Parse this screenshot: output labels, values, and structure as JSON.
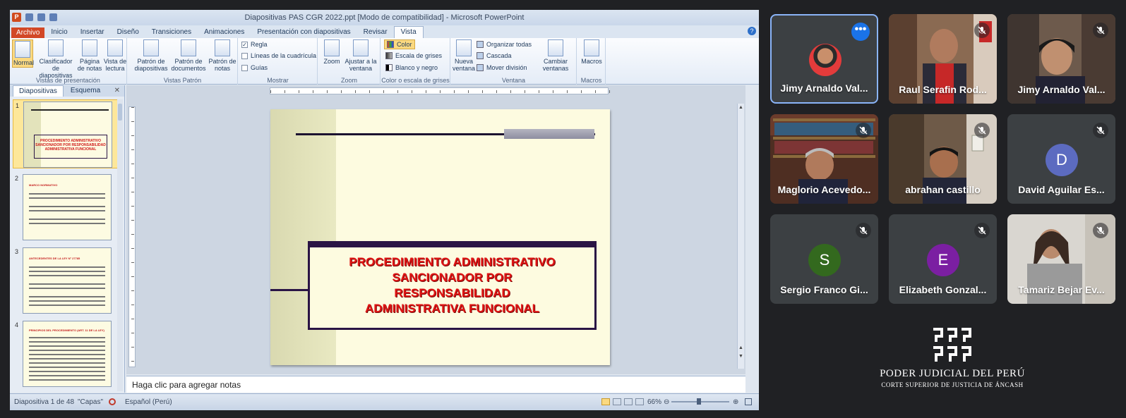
{
  "ppt": {
    "window_title": "Diapositivas PAS CGR 2022.ppt [Modo de compatibilidad] - Microsoft PowerPoint",
    "tabs": [
      "Archivo",
      "Inicio",
      "Insertar",
      "Diseño",
      "Transiciones",
      "Animaciones",
      "Presentación con diapositivas",
      "Revisar",
      "Vista"
    ],
    "active_tab": "Vista",
    "ribbon": {
      "views": {
        "normal": "Normal",
        "sorter": "Clasificador de diapositivas",
        "notes_page": "Página de notas",
        "reading": "Vista de lectura",
        "group": "Vistas de presentación"
      },
      "masters": {
        "slide_master": "Patrón de diapositivas",
        "handout_master": "Patrón de documentos",
        "notes_master": "Patrón de notas",
        "group": "Vistas Patrón"
      },
      "show": {
        "ruler": "Regla",
        "gridlines": "Líneas de la cuadrícula",
        "guides": "Guías",
        "group": "Mostrar",
        "ruler_checked": true
      },
      "zoom": {
        "zoom": "Zoom",
        "fit": "Ajustar a la ventana",
        "group": "Zoom"
      },
      "color": {
        "color": "Color",
        "grayscale": "Escala de grises",
        "bw": "Blanco y negro",
        "group": "Color o escala de grises"
      },
      "window": {
        "new": "Nueva ventana",
        "arrange": "Organizar todas",
        "cascade": "Cascada",
        "move_split": "Mover división",
        "switch": "Cambiar ventanas",
        "group": "Ventana"
      },
      "macros": {
        "macros": "Macros",
        "group": "Macros"
      }
    },
    "pane_tabs": {
      "slides": "Diapositivas",
      "outline": "Esquema"
    },
    "thumbnails": [
      {
        "num": "1",
        "title": "PROCEDIMIENTO ADMINISTRATIVO SANCIONADOR POR RESPONSABILIDAD ADMINISTRATIVA FUNCIONAL"
      },
      {
        "num": "2",
        "title": "MARCO NORMATIVO"
      },
      {
        "num": "3",
        "title": "ANTECEDENTES DE LA LEY N° 27785"
      },
      {
        "num": "4",
        "title": "PRINCIPIOS DEL PROCEDIMIENTO (ART. 11 DE LA LEY)"
      }
    ],
    "slide_title": "PROCEDIMIENTO ADMINISTRATIVO\nSANCIONADOR POR\nRESPONSABILIDAD\nADMINISTRATIVA FUNCIONAL",
    "notes_placeholder": "Haga clic para agregar notas",
    "status": {
      "slide": "Diapositiva 1 de 48",
      "theme": "\"Capas\"",
      "language": "Español (Perú)",
      "zoom": "66%"
    }
  },
  "participants": [
    {
      "name": "Jimy Arnaldo Val...",
      "kind": "photo-avatar",
      "active": true
    },
    {
      "name": "Raul Serafin Rod...",
      "kind": "video",
      "muted": true
    },
    {
      "name": "Jimy Arnaldo Val...",
      "kind": "video",
      "muted": true
    },
    {
      "name": "Maglorio Acevedo...",
      "kind": "video",
      "muted": true
    },
    {
      "name": "abrahan castillo",
      "kind": "video",
      "muted": true
    },
    {
      "name": "David Aguilar Es...",
      "kind": "letter",
      "letter": "D",
      "color": "#5c6bc0",
      "muted": true
    },
    {
      "name": "Sergio Franco Gi...",
      "kind": "letter",
      "letter": "S",
      "color": "#33691e",
      "muted": true
    },
    {
      "name": "Elizabeth Gonzal...",
      "kind": "letter",
      "letter": "E",
      "color": "#7b1fa2",
      "muted": true
    },
    {
      "name": "Tamariz Bejar Ev...",
      "kind": "video",
      "muted": true
    }
  ],
  "logo": {
    "line1": "PODER JUDICIAL DEL PERÚ",
    "line2": "CORTE SUPERIOR DE JUSTICIA DE ÁNCASH"
  }
}
